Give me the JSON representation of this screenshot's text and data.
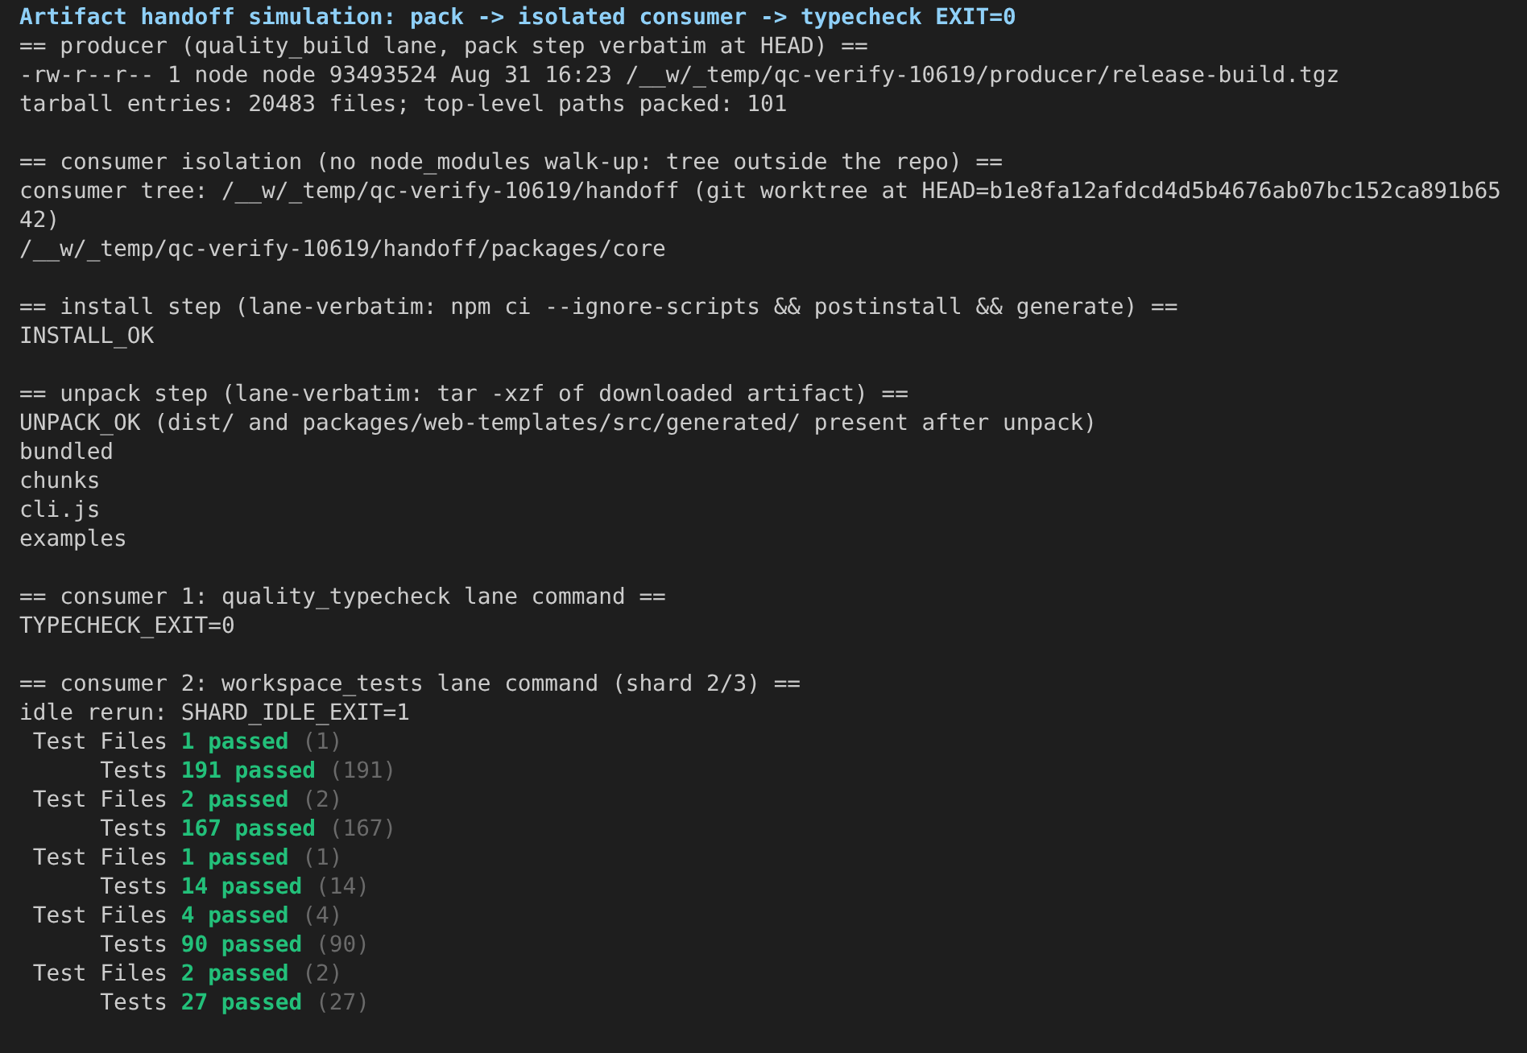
{
  "title": "Artifact handoff simulation: pack -> isolated consumer -> typecheck EXIT=0",
  "sections": [
    {
      "lines": [
        "== producer (quality_build lane, pack step verbatim at HEAD) ==",
        "-rw-r--r-- 1 node node 93493524 Aug 31 16:23 /__w/_temp/qc-verify-10619/producer/release-build.tgz",
        "tarball entries: 20483 files; top-level paths packed: 101"
      ]
    },
    {
      "lines": [
        "== consumer isolation (no node_modules walk-up: tree outside the repo) ==",
        "consumer tree: /__w/_temp/qc-verify-10619/handoff (git worktree at HEAD=b1e8fa12afdcd4d5b4676ab07bc152ca891b6542)",
        "/__w/_temp/qc-verify-10619/handoff/packages/core"
      ]
    },
    {
      "lines": [
        "== install step (lane-verbatim: npm ci --ignore-scripts && postinstall && generate) ==",
        "INSTALL_OK"
      ]
    },
    {
      "lines": [
        "== unpack step (lane-verbatim: tar -xzf of downloaded artifact) ==",
        "UNPACK_OK (dist/ and packages/web-templates/src/generated/ present after unpack)",
        "bundled",
        "chunks",
        "cli.js",
        "examples"
      ]
    },
    {
      "lines": [
        "== consumer 1: quality_typecheck lane command ==",
        "TYPECHECK_EXIT=0"
      ]
    },
    {
      "lines": [
        "== consumer 2: workspace_tests lane command (shard 2/3) ==",
        "idle rerun: SHARD_IDLE_EXIT=1"
      ],
      "results": [
        {
          "label": "Test Files",
          "passed": "1 passed",
          "total": "(1)"
        },
        {
          "label": "Tests",
          "passed": "191 passed",
          "total": "(191)"
        },
        {
          "label": "Test Files",
          "passed": "2 passed",
          "total": "(2)"
        },
        {
          "label": "Tests",
          "passed": "167 passed",
          "total": "(167)"
        },
        {
          "label": "Test Files",
          "passed": "1 passed",
          "total": "(1)"
        },
        {
          "label": "Tests",
          "passed": "14 passed",
          "total": "(14)"
        },
        {
          "label": "Test Files",
          "passed": "4 passed",
          "total": "(4)"
        },
        {
          "label": "Tests",
          "passed": "90 passed",
          "total": "(90)"
        },
        {
          "label": "Test Files",
          "passed": "2 passed",
          "total": "(2)"
        },
        {
          "label": "Tests",
          "passed": "27 passed",
          "total": "(27)"
        }
      ]
    }
  ]
}
